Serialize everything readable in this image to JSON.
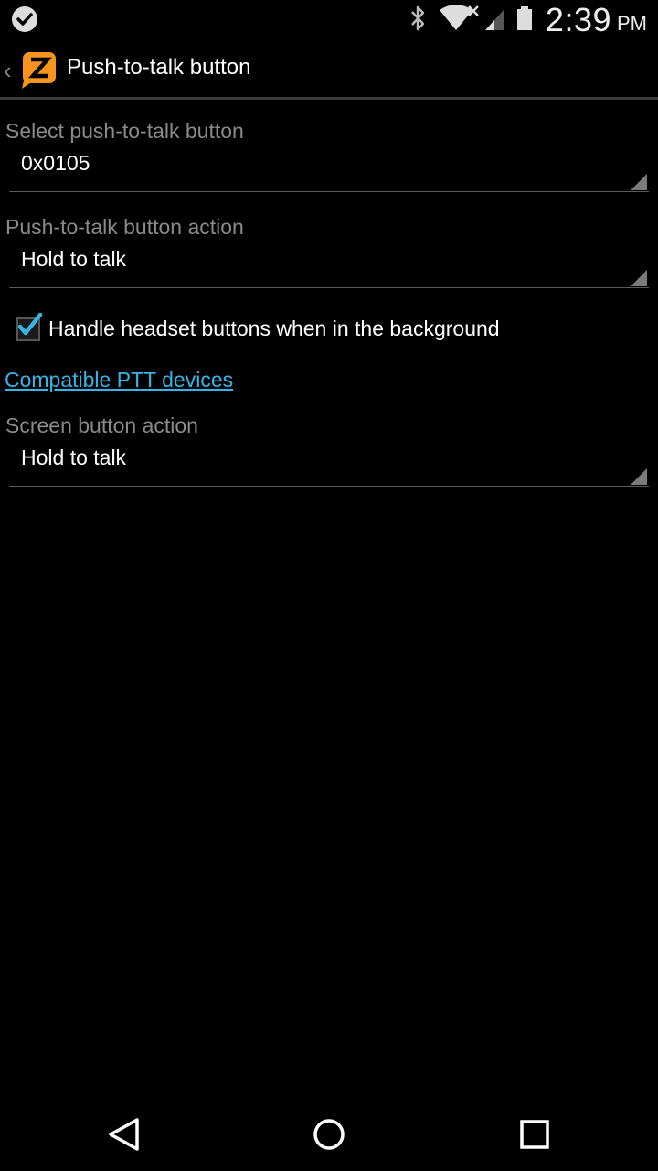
{
  "status_bar": {
    "time": "2:39",
    "ampm": "PM",
    "icons": [
      "check-circle-icon",
      "bluetooth-icon",
      "wifi-icon",
      "signal-icon",
      "battery-icon"
    ]
  },
  "action_bar": {
    "back_icon": "chevron-left-icon",
    "logo": "zello-logo",
    "title": "Push-to-talk button"
  },
  "settings": {
    "ptt_button": {
      "label": "Select push-to-talk button",
      "value": "0x0105"
    },
    "ptt_action": {
      "label": "Push-to-talk button action",
      "value": "Hold to talk"
    },
    "headset_background": {
      "label": "Handle headset buttons when in the background",
      "checked": true
    },
    "compatible_link": "Compatible PTT devices",
    "screen_action": {
      "label": "Screen button action",
      "value": "Hold to talk"
    }
  },
  "nav_bar": {
    "icons": [
      "back-triangle-icon",
      "home-circle-icon",
      "recents-square-icon"
    ]
  },
  "colors": {
    "accent": "#33b5e5",
    "logo": "#f7941d",
    "background": "#000000",
    "label_gray": "#8a8a8a"
  }
}
